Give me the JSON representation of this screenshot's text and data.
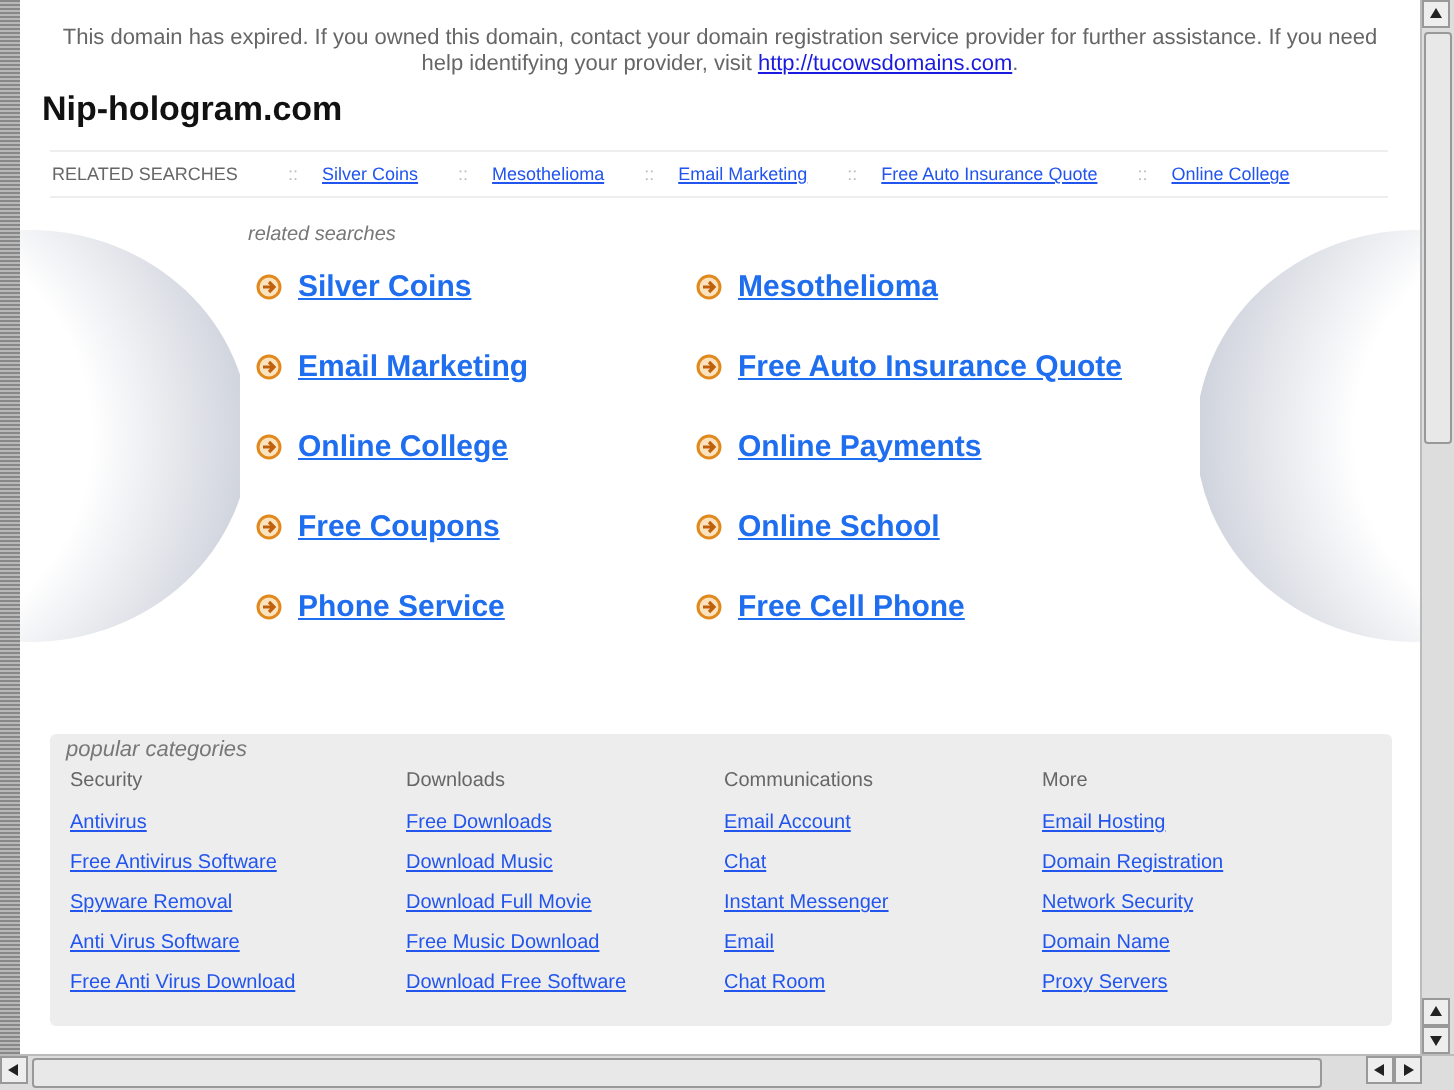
{
  "notice": {
    "text": "This domain has expired. If you owned this domain, contact your domain registration service provider for further assistance. If you need help identifying your provider, visit",
    "link": "http://tucowsdomains.com",
    "end": "."
  },
  "site_title": "Nip-hologram.com",
  "related_bar": {
    "label": "RELATED SEARCHES",
    "separator": "::",
    "links": [
      "Silver Coins",
      "Mesothelioma",
      "Email Marketing",
      "Free Auto Insurance Quote",
      "Online College"
    ]
  },
  "related_searches": {
    "heading": "related searches",
    "links": [
      "Silver Coins",
      "Mesothelioma",
      "Email Marketing",
      "Free Auto Insurance Quote",
      "Online College",
      "Online Payments",
      "Free Coupons",
      "Online School",
      "Phone Service",
      "Free Cell Phone"
    ]
  },
  "popular_categories": {
    "heading": "popular categories",
    "columns": [
      {
        "title": "Security",
        "links": [
          "Antivirus",
          "Free Antivirus Software",
          "Spyware Removal",
          "Anti Virus Software",
          "Free Anti Virus Download"
        ]
      },
      {
        "title": "Downloads",
        "links": [
          "Free Downloads",
          "Download Music",
          "Download Full Movie",
          "Free Music Download",
          "Download Free Software"
        ]
      },
      {
        "title": "Communications",
        "links": [
          "Email Account",
          "Chat",
          "Instant Messenger",
          "Email",
          "Chat Room"
        ]
      },
      {
        "title": "More",
        "links": [
          "Email Hosting",
          "Domain Registration",
          "Network Security",
          "Domain Name",
          "Proxy Servers"
        ]
      }
    ]
  }
}
